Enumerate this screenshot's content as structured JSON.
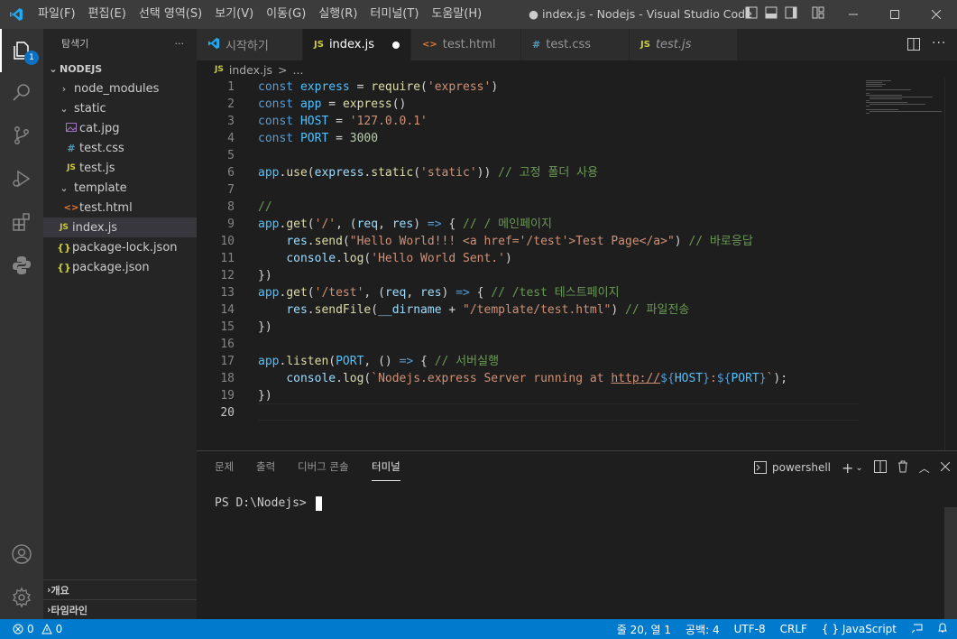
{
  "titlebar": {
    "menu": [
      "파일(F)",
      "편집(E)",
      "선택 영역(S)",
      "보기(V)",
      "이동(G)",
      "실행(R)",
      "터미널(T)",
      "도움말(H)"
    ],
    "title": "● index.js - Nodejs - Visual Studio Code"
  },
  "activity": {
    "explorer_badge": "1"
  },
  "sidebar": {
    "header": "탐색기",
    "more": "···",
    "root": "NODEJS",
    "items": [
      {
        "label": "node_modules",
        "icon": ""
      },
      {
        "label": "static",
        "icon": ""
      },
      {
        "label": "cat.jpg",
        "icon": "image-icon"
      },
      {
        "label": "test.css",
        "icon": "#"
      },
      {
        "label": "test.js",
        "icon": "JS"
      },
      {
        "label": "template",
        "icon": ""
      },
      {
        "label": "test.html",
        "icon": "<>"
      },
      {
        "label": "index.js",
        "icon": "JS"
      },
      {
        "label": "package-lock.json",
        "icon": "{}"
      },
      {
        "label": "package.json",
        "icon": "{}"
      }
    ],
    "outline": "개요",
    "timeline": "타임라인"
  },
  "tabs": [
    {
      "label": "시작하기",
      "icon": "vscode-icon"
    },
    {
      "label": "index.js",
      "icon": "JS"
    },
    {
      "label": "test.html",
      "icon": "<>"
    },
    {
      "label": "test.css",
      "icon": "#"
    },
    {
      "label": "test.js",
      "icon": "JS"
    }
  ],
  "breadcrumb": {
    "file": "index.js",
    "sep": ">",
    "rest": "..."
  },
  "editor": {
    "line_numbers": [
      "1",
      "2",
      "3",
      "4",
      "5",
      "6",
      "7",
      "8",
      "9",
      "10",
      "11",
      "12",
      "13",
      "14",
      "15",
      "16",
      "17",
      "18",
      "19",
      "20"
    ]
  },
  "panel": {
    "tabs": [
      "문제",
      "출력",
      "디버그 콘솔",
      "터미널"
    ],
    "shell": "powershell",
    "prompt": "PS D:\\Nodejs> "
  },
  "status": {
    "errors": "0",
    "warnings": "0",
    "position": "줄 20, 열 1",
    "spaces": "공백: 4",
    "encoding": "UTF-8",
    "eol": "CRLF",
    "language": "JavaScript"
  },
  "colors": {
    "accent": "#007acc",
    "badge": "#0e70c0",
    "js_icon": "#cbcb41",
    "html_icon": "#e37933",
    "css_icon": "#519aba",
    "json_icon": "#cbcb41"
  }
}
